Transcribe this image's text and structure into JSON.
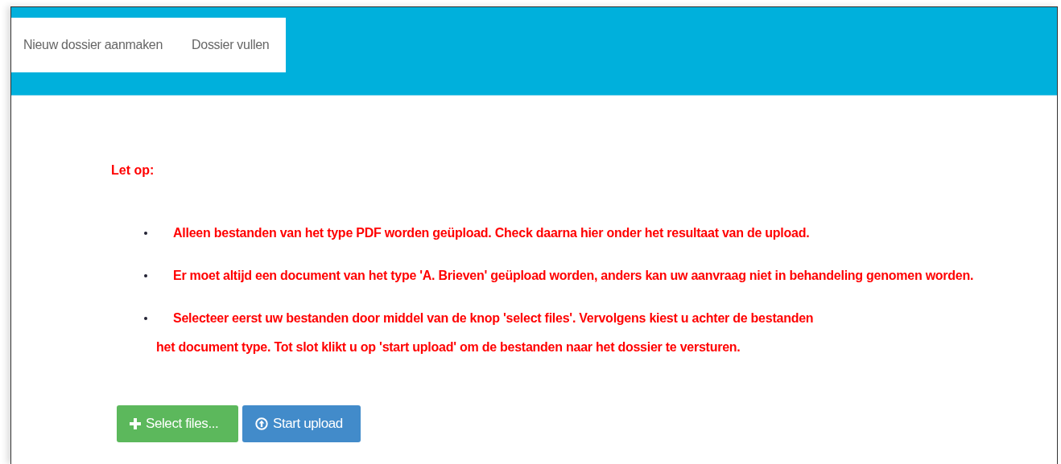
{
  "nav": {
    "tabs": [
      {
        "label": "Nieuw dossier aanmaken"
      },
      {
        "label": "Dossier vullen"
      }
    ]
  },
  "notice": {
    "heading": "Let op:",
    "items": [
      {
        "lines": [
          "Alleen bestanden van het type PDF worden geüpload. Check daarna hier onder het resultaat van de upload."
        ]
      },
      {
        "lines": [
          "Er moet altijd een document van het type 'A. Brieven' geüpload worden, anders kan uw aanvraag niet in behandeling genomen worden."
        ]
      },
      {
        "lines": [
          "Selecteer eerst uw bestanden door middel van de knop 'select files'. Vervolgens kiest u achter de bestanden",
          "het document type. Tot slot klikt u op 'start upload' om de bestanden naar het dossier te versturen."
        ]
      }
    ]
  },
  "buttons": [
    {
      "kind": "select",
      "label": "Select files..."
    },
    {
      "kind": "upload",
      "label": "Start upload"
    }
  ]
}
